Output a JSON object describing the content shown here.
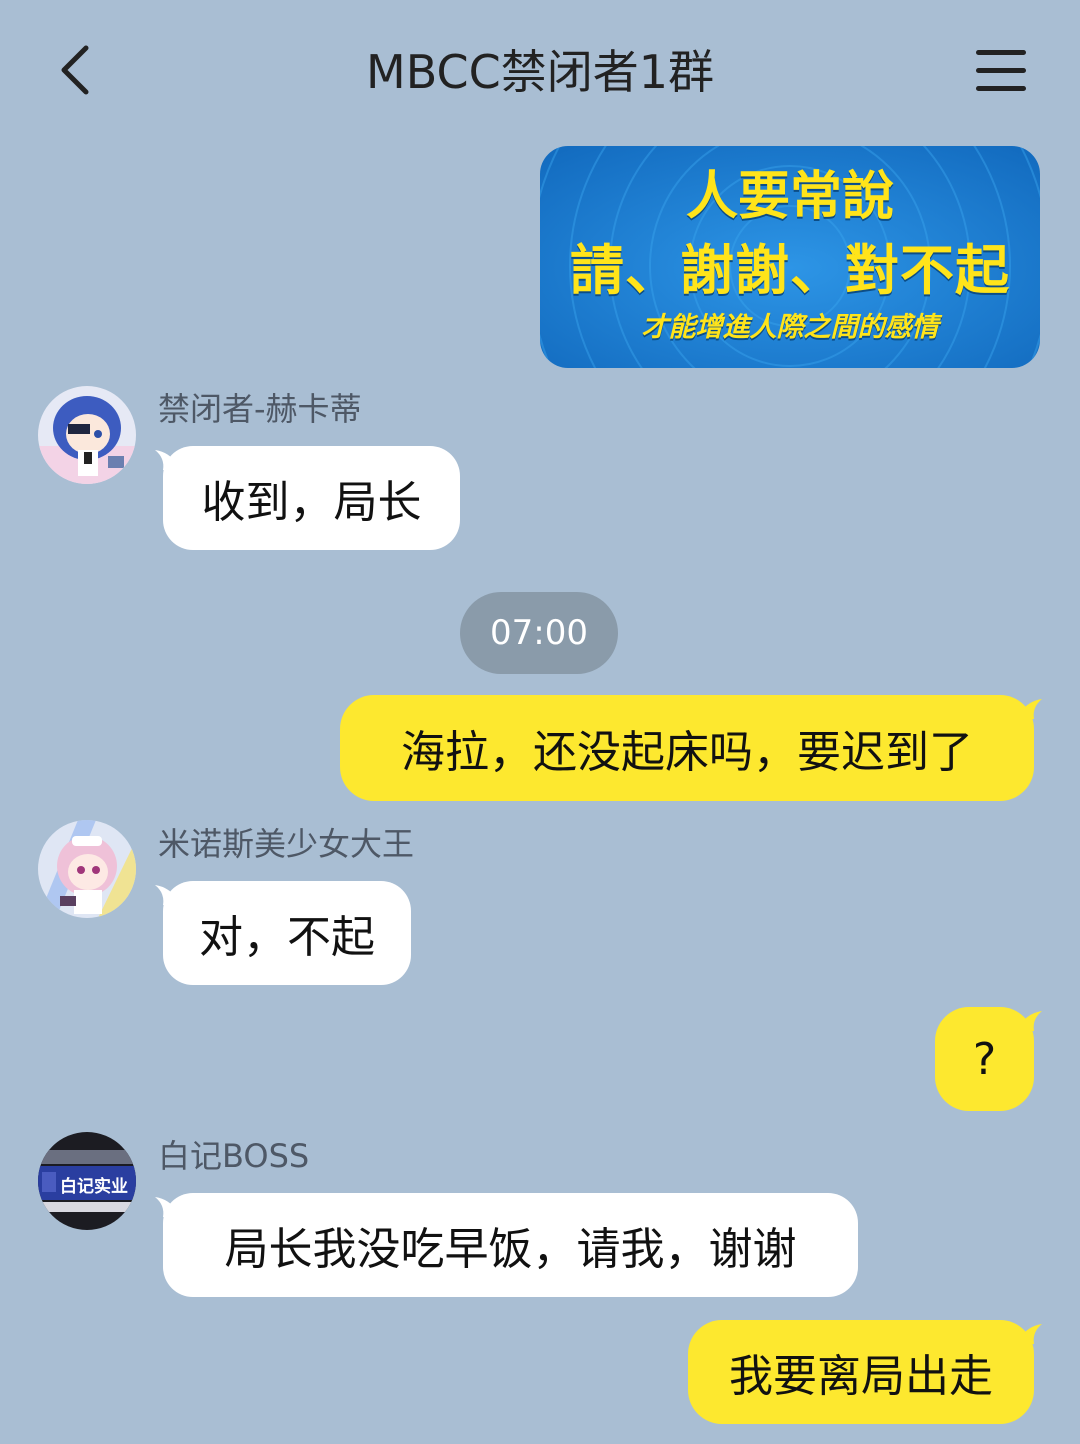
{
  "header": {
    "title": "MBCC禁闭者1群",
    "back_icon": "chevron-left-icon",
    "menu_icon": "hamburger-menu-icon"
  },
  "colors": {
    "background": "#a9bed3",
    "outgoing_bubble": "#fde82f",
    "incoming_bubble": "#ffffff",
    "time_pill": "#8a9baa",
    "poster_bg": "#1a7ed1",
    "poster_text": "#ffe41a"
  },
  "messages": [
    {
      "direction": "out",
      "type": "image",
      "image_text": [
        "人要常說",
        "請、謝謝、對不起",
        "才能增進人際之間的感情"
      ]
    },
    {
      "direction": "in",
      "sender": "禁闭者-赫卡蒂",
      "avatar": "avatar-blue-hair-girl",
      "text": "收到，局长"
    },
    {
      "type": "time",
      "text": "07:00"
    },
    {
      "direction": "out",
      "text": "海拉，还没起床吗，要迟到了"
    },
    {
      "direction": "in",
      "sender": "米诺斯美少女大王",
      "avatar": "avatar-pink-hair-girl",
      "text": "对，不起"
    },
    {
      "direction": "out",
      "text": "?"
    },
    {
      "direction": "in",
      "sender": "白记BOSS",
      "avatar": "avatar-shop-sign",
      "avatar_text": "白记实业",
      "text": "局长我没吃早饭，请我，谢谢"
    },
    {
      "direction": "out",
      "text": "我要离局出走"
    }
  ]
}
